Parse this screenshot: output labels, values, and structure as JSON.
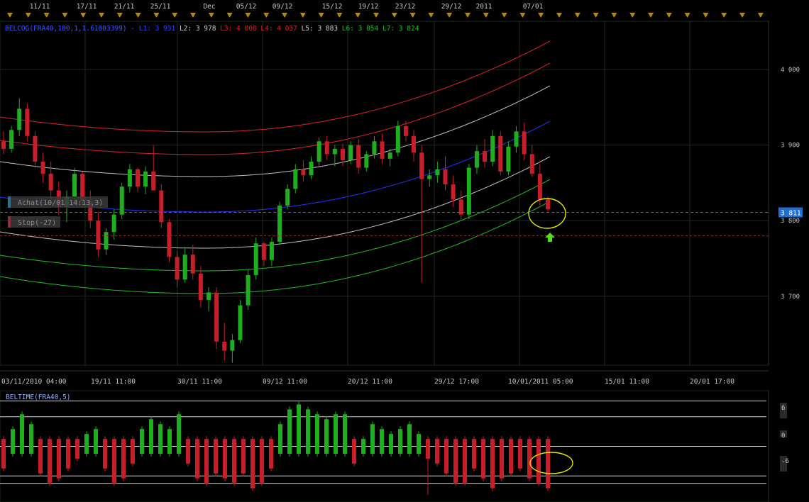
{
  "colors": {
    "background": "#000000",
    "grid": "#1e2a1e",
    "axis_text": "#c8c8c8",
    "up_candle": "#1fae1f",
    "down_candle": "#c81e2a",
    "red_band": "#e02222",
    "white_band": "#c0c0c0",
    "blue_band": "#2233ff",
    "green_band": "#22bb22",
    "highlight_ellipse": "#e6e600",
    "arrow": "#55dd22",
    "price_tag_bg": "#1f6fd0"
  },
  "top_date_labels": [
    "11/11",
    "17/11",
    "21/11",
    "25/11",
    "Dec",
    "05/12",
    "09/12",
    "15/12",
    "19/12",
    "23/12",
    "29/12",
    "2011",
    "07/01"
  ],
  "main_chart": {
    "legend": {
      "name": "BELCOG(FRA40,180,1,1.61803399)",
      "items": [
        {
          "text": "L1: 3 931",
          "color": "#3344ff"
        },
        {
          "text": "L2: 3 978",
          "color": "#d0d0d0"
        },
        {
          "text": "L3: 4 008",
          "color": "#e02222"
        },
        {
          "text": "L4: 4 037",
          "color": "#e02222"
        },
        {
          "text": "L5: 3 883",
          "color": "#d0d0d0"
        },
        {
          "text": "L6: 3 854",
          "color": "#22bb22"
        },
        {
          "text": "L7: 3 824",
          "color": "#22bb22"
        }
      ]
    },
    "y_ticks": [
      {
        "value": 4000,
        "label": "4 000"
      },
      {
        "value": 3900,
        "label": "3 900"
      },
      {
        "value": 3800,
        "label": "3 800"
      },
      {
        "value": 3700,
        "label": "3 700"
      }
    ],
    "x_labels": [
      "03/11/2010 04:00",
      "19/11 11:00",
      "30/11 11:00",
      "09/12 11:00",
      "20/12 11:00",
      "29/12 17:00",
      "10/01/2011 05:00",
      "15/01 11:00",
      "20/01 17:00"
    ],
    "last_price_label": "3 811",
    "order_labels": [
      {
        "text": "Achat(10/01 14:13,3)",
        "price": 3824
      },
      {
        "text": "Stop(-27)",
        "price": 3797
      }
    ]
  },
  "indicator_panel": {
    "title": "BELTIME(FRA40,5)",
    "tick_labels": [
      "6",
      "0",
      "-6"
    ]
  },
  "chart_data": [
    {
      "type": "candlestick",
      "title": "BELCOG(FRA40,180,1,1.61803399)",
      "ylim": [
        3610,
        4080
      ],
      "y_ticks": [
        3700,
        3800,
        3900,
        4000
      ],
      "candles": [
        [
          3905,
          3918,
          3888,
          3895
        ],
        [
          3895,
          3925,
          3890,
          3920
        ],
        [
          3920,
          3962,
          3912,
          3948
        ],
        [
          3948,
          3955,
          3905,
          3912
        ],
        [
          3912,
          3918,
          3870,
          3878
        ],
        [
          3878,
          3890,
          3850,
          3862
        ],
        [
          3862,
          3878,
          3828,
          3840
        ],
        [
          3840,
          3852,
          3808,
          3818
        ],
        [
          3818,
          3840,
          3798,
          3832
        ],
        [
          3832,
          3870,
          3825,
          3862
        ],
        [
          3862,
          3865,
          3820,
          3826
        ],
        [
          3826,
          3840,
          3790,
          3800
        ],
        [
          3800,
          3812,
          3752,
          3762
        ],
        [
          3762,
          3790,
          3755,
          3785
        ],
        [
          3785,
          3815,
          3775,
          3808
        ],
        [
          3808,
          3850,
          3802,
          3845
        ],
        [
          3845,
          3875,
          3838,
          3868
        ],
        [
          3868,
          3870,
          3838,
          3845
        ],
        [
          3845,
          3872,
          3835,
          3865
        ],
        [
          3865,
          3900,
          3855,
          3840
        ],
        [
          3840,
          3848,
          3790,
          3798
        ],
        [
          3798,
          3802,
          3745,
          3752
        ],
        [
          3752,
          3760,
          3712,
          3722
        ],
        [
          3722,
          3765,
          3718,
          3755
        ],
        [
          3755,
          3768,
          3722,
          3730
        ],
        [
          3730,
          3740,
          3685,
          3695
        ],
        [
          3695,
          3712,
          3680,
          3705
        ],
        [
          3705,
          3712,
          3630,
          3640
        ],
        [
          3640,
          3665,
          3615,
          3628
        ],
        [
          3628,
          3650,
          3612,
          3642
        ],
        [
          3642,
          3695,
          3638,
          3688
        ],
        [
          3688,
          3735,
          3682,
          3728
        ],
        [
          3728,
          3778,
          3722,
          3770
        ],
        [
          3770,
          3772,
          3740,
          3748
        ],
        [
          3748,
          3778,
          3740,
          3772
        ],
        [
          3772,
          3825,
          3768,
          3820
        ],
        [
          3820,
          3848,
          3815,
          3842
        ],
        [
          3842,
          3875,
          3836,
          3868
        ],
        [
          3868,
          3880,
          3852,
          3860
        ],
        [
          3860,
          3885,
          3855,
          3878
        ],
        [
          3878,
          3910,
          3872,
          3905
        ],
        [
          3905,
          3912,
          3880,
          3888
        ],
        [
          3888,
          3900,
          3872,
          3895
        ],
        [
          3895,
          3902,
          3872,
          3880
        ],
        [
          3880,
          3905,
          3875,
          3900
        ],
        [
          3900,
          3908,
          3862,
          3870
        ],
        [
          3870,
          3892,
          3865,
          3888
        ],
        [
          3888,
          3912,
          3882,
          3905
        ],
        [
          3905,
          3915,
          3875,
          3882
        ],
        [
          3882,
          3895,
          3872,
          3890
        ],
        [
          3890,
          3932,
          3885,
          3925
        ],
        [
          3925,
          3932,
          3905,
          3912
        ],
        [
          3912,
          3920,
          3878,
          3890
        ],
        [
          3890,
          3900,
          3718,
          3855
        ],
        [
          3855,
          3868,
          3845,
          3860
        ],
        [
          3860,
          3878,
          3850,
          3868
        ],
        [
          3868,
          3885,
          3840,
          3848
        ],
        [
          3848,
          3860,
          3818,
          3828
        ],
        [
          3828,
          3840,
          3800,
          3808
        ],
        [
          3808,
          3875,
          3802,
          3870
        ],
        [
          3870,
          3900,
          3862,
          3892
        ],
        [
          3892,
          3908,
          3870,
          3878
        ],
        [
          3878,
          3920,
          3872,
          3912
        ],
        [
          3912,
          3918,
          3860,
          3865
        ],
        [
          3865,
          3905,
          3860,
          3898
        ],
        [
          3898,
          3925,
          3890,
          3918
        ],
        [
          3918,
          3930,
          3880,
          3888
        ],
        [
          3888,
          3900,
          3858,
          3862
        ],
        [
          3862,
          3875,
          3820,
          3828
        ],
        [
          3828,
          3832,
          3812,
          3815
        ]
      ]
    },
    {
      "type": "bar",
      "title": "BELTIME(FRA40,5)",
      "ylim": [
        -11,
        11
      ],
      "reference_lines": [
        9.2,
        6,
        0,
        -6,
        -7.5
      ],
      "values": [
        -3,
        2,
        5,
        3,
        -4,
        -6,
        -5,
        -3,
        -1,
        1,
        2,
        -3,
        -6,
        -5,
        -2,
        2,
        4,
        3,
        2,
        5,
        -2,
        -5,
        -6,
        -4,
        -5,
        -6,
        -4,
        -7,
        -6,
        -3,
        3,
        6,
        7,
        6,
        5,
        4,
        5,
        5,
        -2,
        0,
        3,
        2,
        1,
        2,
        3,
        1,
        -1,
        -2,
        -4,
        -6,
        -6,
        -3,
        -5,
        -7,
        -5,
        -4,
        -3,
        -5,
        -6,
        -7
      ]
    }
  ]
}
